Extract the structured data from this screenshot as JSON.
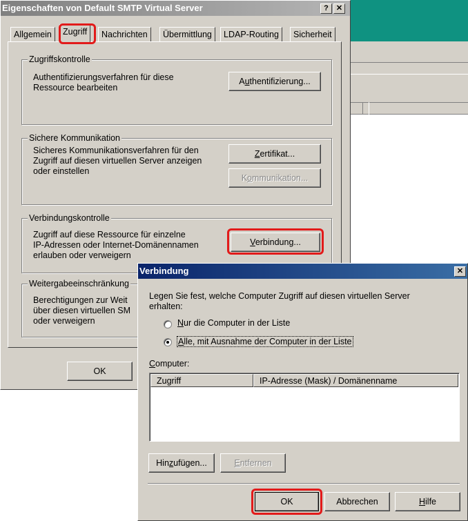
{
  "main_dialog": {
    "title": "Eigenschaften von Default SMTP Virtual Server",
    "help_btn": "?",
    "close_btn": "✕",
    "tabs": [
      "Allgemein",
      "Zugriff",
      "Nachrichten",
      "Übermittlung",
      "LDAP-Routing",
      "Sicherheit"
    ],
    "selected_tab": "Zugriff",
    "groups": {
      "access_control": {
        "title": "Zugriffskontrolle",
        "description": [
          "Authentifizierungsverfahren für diese",
          "Ressource bearbeiten"
        ],
        "button_pre": "A",
        "button_ul": "u",
        "button_post": "thentifizierung..."
      },
      "secure_comm": {
        "title": "Sichere Kommunikation",
        "description": [
          "Sicheres Kommunikationsverfahren für den",
          "Zugriff auf diesen virtuellen Server anzeigen",
          "oder einstellen"
        ],
        "cert_pre": "",
        "cert_ul": "Z",
        "cert_post": "ertifikat...",
        "comm_pre": "K",
        "comm_ul": "o",
        "comm_post": "mmunikation..."
      },
      "connection_control": {
        "title": "Verbindungskontrolle",
        "description": [
          "Zugriff auf diese Ressource für einzelne",
          "IP-Adressen oder Internet-Domänennamen",
          "erlauben oder verweigern"
        ],
        "button_pre": "",
        "button_ul": "V",
        "button_post": "erbindung..."
      },
      "relay_restrictions": {
        "title": "Weitergabeeinschränkung",
        "description": [
          "Berechtigungen zur Weit",
          "über diesen virtuellen SM",
          "oder verweigern"
        ]
      }
    },
    "ok_label": "OK"
  },
  "connection_dialog": {
    "title": "Verbindung",
    "close_btn": "✕",
    "intro": [
      "Legen Sie fest, welche Computer Zugriff auf diesen virtuellen Server",
      "erhalten:"
    ],
    "radio_only": {
      "pre": "",
      "ul": "N",
      "post": "ur die Computer in der Liste"
    },
    "radio_all": {
      "pre": "",
      "ul": "A",
      "post": "lle, mit Ausnahme der Computer in der Liste"
    },
    "selected_radio": "all",
    "computers_pre": "",
    "computers_ul": "C",
    "computers_post": "omputer:",
    "columns": [
      "Zugriff",
      "IP-Adresse (Mask) / Domänenname"
    ],
    "rows": [],
    "add_pre": "Hin",
    "add_ul": "z",
    "add_post": "ufügen...",
    "remove_pre": "",
    "remove_ul": "E",
    "remove_post": "ntfernen",
    "ok_label": "OK",
    "cancel_label": "Abbrechen",
    "help_pre": "",
    "help_ul": "H",
    "help_post": "ilfe"
  },
  "colors": {
    "highlight": "#e21a1a",
    "active_title": "#0a246a",
    "inactive_title": "#808080",
    "face": "#d4d0c8",
    "background_app": "#0f9281"
  }
}
